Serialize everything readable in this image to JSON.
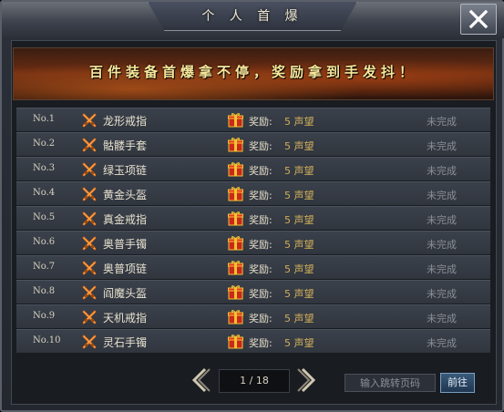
{
  "window": {
    "title": "个 人 首 爆"
  },
  "banner": {
    "text": "百件装备首爆拿不停，奖励拿到手发抖！"
  },
  "rows": [
    {
      "no": "No.1",
      "item": "龙形戒指",
      "reward_label": "奖励:",
      "reward_value": "5 声望",
      "status": "未完成"
    },
    {
      "no": "No.2",
      "item": "骷髅手套",
      "reward_label": "奖励:",
      "reward_value": "5 声望",
      "status": "未完成"
    },
    {
      "no": "No.3",
      "item": "绿玉项链",
      "reward_label": "奖励:",
      "reward_value": "5 声望",
      "status": "未完成"
    },
    {
      "no": "No.4",
      "item": "黄金头盔",
      "reward_label": "奖励:",
      "reward_value": "5 声望",
      "status": "未完成"
    },
    {
      "no": "No.5",
      "item": "真金戒指",
      "reward_label": "奖励:",
      "reward_value": "5 声望",
      "status": "未完成"
    },
    {
      "no": "No.6",
      "item": "奥普手镯",
      "reward_label": "奖励:",
      "reward_value": "5 声望",
      "status": "未完成"
    },
    {
      "no": "No.7",
      "item": "奥普项链",
      "reward_label": "奖励:",
      "reward_value": "5 声望",
      "status": "未完成"
    },
    {
      "no": "No.8",
      "item": "阎魔头盔",
      "reward_label": "奖励:",
      "reward_value": "5 声望",
      "status": "未完成"
    },
    {
      "no": "No.9",
      "item": "天机戒指",
      "reward_label": "奖励:",
      "reward_value": "5 声望",
      "status": "未完成"
    },
    {
      "no": "No.10",
      "item": "灵石手镯",
      "reward_label": "奖励:",
      "reward_value": "5 声望",
      "status": "未完成"
    }
  ],
  "pager": {
    "indicator": "1 / 18",
    "jump_placeholder": "输入跳转页码",
    "go_label": "前往"
  },
  "icons": {
    "close": "close-icon",
    "row_item": "crossed-swords-icon",
    "reward": "gift-box-icon",
    "prev": "chevron-left-icon",
    "next": "chevron-right-icon"
  },
  "colors": {
    "banner_text": "#f7e79a",
    "reward_value": "#cfae5a",
    "status_incomplete": "#8b8f96",
    "swords": "#e8741c",
    "gift": "#d8321e"
  }
}
